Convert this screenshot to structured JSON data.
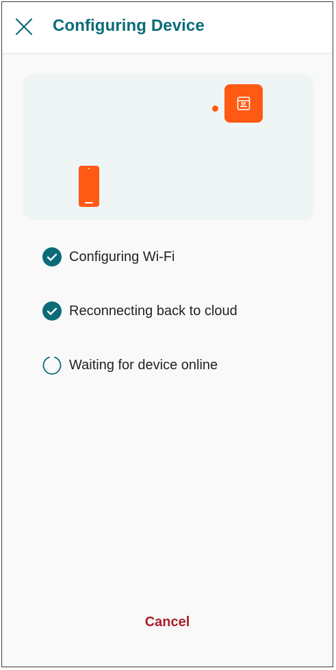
{
  "header": {
    "title": "Configuring Device",
    "close_icon": "close-icon"
  },
  "illustration": {
    "device_icon": "device-box-icon",
    "phone_icon": "phone-icon",
    "accent_color": "#ff5a14",
    "background_color": "#eff5f5"
  },
  "steps": [
    {
      "label": "Configuring Wi-Fi",
      "status": "done",
      "icon": "check-circle-icon"
    },
    {
      "label": "Reconnecting back to cloud",
      "status": "done",
      "icon": "check-circle-icon"
    },
    {
      "label": "Waiting for device online",
      "status": "in-progress",
      "icon": "spinner-icon"
    }
  ],
  "footer": {
    "cancel_label": "Cancel"
  },
  "colors": {
    "primary": "#0b6b78",
    "danger": "#a3212c"
  }
}
